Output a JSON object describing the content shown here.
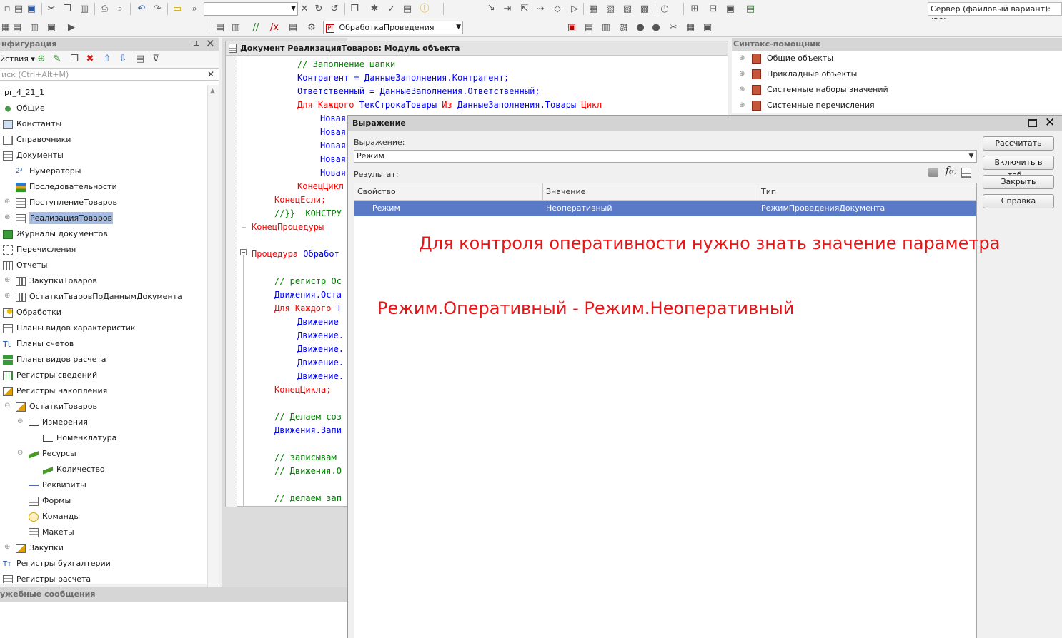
{
  "toolbar": {
    "search_value": "",
    "procedure_combo": "ОбработкаПроведения",
    "server_status": "Сервер (файловый вариант): (20),"
  },
  "config_panel": {
    "title": "нфигурация",
    "actions_label": "йствия",
    "search_placeholder": "иск (Ctrl+Alt+M)",
    "root": "pr_4_21_1",
    "items": [
      {
        "label": "Общие",
        "icon": "common-icon"
      },
      {
        "label": "Константы",
        "icon": "constants-icon"
      },
      {
        "label": "Справочники",
        "icon": "catalogs-icon"
      },
      {
        "label": "Документы",
        "icon": "documents-icon"
      },
      {
        "label": "Нумераторы",
        "icon": "numerators-icon"
      },
      {
        "label": "Последовательности",
        "icon": "sequences-icon"
      },
      {
        "label": "ПоступлениеТоваров",
        "icon": "document-icon"
      },
      {
        "label": "РеализацияТоваров",
        "icon": "document-icon",
        "selected": true
      },
      {
        "label": "Журналы документов",
        "icon": "journals-icon"
      },
      {
        "label": "Перечисления",
        "icon": "enums-icon"
      },
      {
        "label": "Отчеты",
        "icon": "reports-icon"
      },
      {
        "label": "ЗакупкиТоваров",
        "icon": "report-icon"
      },
      {
        "label": "ОстаткиТваровПоДаннымДокумента",
        "icon": "report-icon"
      },
      {
        "label": "Обработки",
        "icon": "dataprocessors-icon"
      },
      {
        "label": "Планы видов характеристик",
        "icon": "chart-of-characteristic-types-icon"
      },
      {
        "label": "Планы счетов",
        "icon": "chart-of-accounts-icon"
      },
      {
        "label": "Планы видов расчета",
        "icon": "chart-of-calculation-types-icon"
      },
      {
        "label": "Регистры сведений",
        "icon": "information-registers-icon"
      },
      {
        "label": "Регистры накопления",
        "icon": "accumulation-registers-icon"
      },
      {
        "label": "ОстаткиТоваров",
        "icon": "accumulation-register-icon"
      },
      {
        "label": "Измерения",
        "icon": "dimensions-icon"
      },
      {
        "label": "Номенклатура",
        "icon": "dimension-icon"
      },
      {
        "label": "Ресурсы",
        "icon": "resources-icon"
      },
      {
        "label": "Количество",
        "icon": "resource-icon"
      },
      {
        "label": "Реквизиты",
        "icon": "attributes-icon"
      },
      {
        "label": "Формы",
        "icon": "forms-icon"
      },
      {
        "label": "Команды",
        "icon": "commands-icon"
      },
      {
        "label": "Макеты",
        "icon": "templates-icon"
      },
      {
        "label": "Закупки",
        "icon": "accumulation-register-icon"
      },
      {
        "label": "Регистры бухгалтерии",
        "icon": "accounting-registers-icon"
      },
      {
        "label": "Регистры расчета",
        "icon": "calculation-registers-icon"
      }
    ]
  },
  "messages_panel": {
    "title": "ужебные сообщения"
  },
  "editor": {
    "title": "Документ РеализацияТоваров: Модуль объекта",
    "lines": [
      "// Заполнение шапки",
      "Контрагент = ДанныеЗаполнения.Контрагент;",
      "Ответственный = ДанныеЗаполнения.Ответственный;",
      "Для Каждого ТекСтрокаТовары Из ДанныеЗаполнения.Товары Цикл",
      "Новая",
      "Новая",
      "Новая",
      "Новая",
      "Новая",
      "КонецЦикл",
      "КонецЕсли;",
      "//}}__КОНСТРУ",
      "КонецПроцедуры",
      "Процедура Обработ",
      "// регистр Ос",
      "Движения.Оста",
      "Для Каждого Т",
      "Движение",
      "Движение.",
      "Движение.",
      "Движение.",
      "Движение.",
      "КонецЦикла;",
      "// Делаем соз",
      "Движения.Запи",
      "// записывам",
      "// Движения.О",
      "// делаем зап"
    ]
  },
  "syntax_helper": {
    "title": "Синтакс-помощник",
    "items": [
      "Общие объекты",
      "Прикладные объекты",
      "Системные наборы значений",
      "Системные перечисления"
    ]
  },
  "dialog": {
    "title": "Выражение",
    "expression_label": "Выражение:",
    "expression_value": "Режим",
    "result_label": "Результат:",
    "columns": [
      "Свойство",
      "Значение",
      "Тип"
    ],
    "rows": [
      {
        "property": "Режим",
        "value": "Неоперативный",
        "type": "РежимПроведенияДокумента"
      }
    ],
    "buttons": {
      "calculate": "Рассчитать",
      "include_table": "Включить в таб...",
      "close": "Закрыть",
      "help": "Справка"
    },
    "annotation_1": "Для контроля оперативности нужно знать значение параметра",
    "annotation_2": "Режим.Оперативный - Режим.Неоперативный"
  },
  "colors": {
    "keyword": "#ff0000",
    "identifier": "#0000ff",
    "comment": "#008000",
    "selection": "#5a79c6",
    "annotation": "#e81416"
  }
}
